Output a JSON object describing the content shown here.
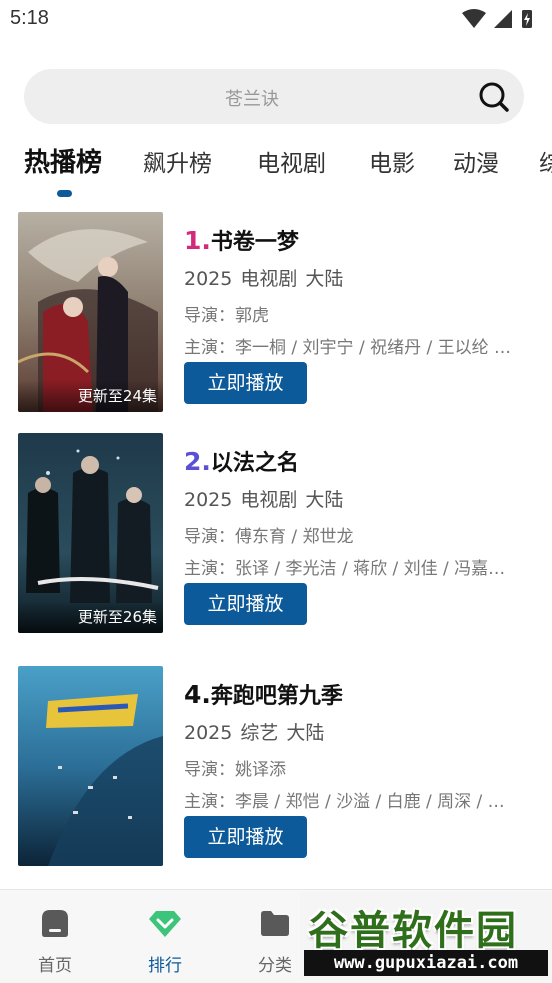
{
  "status_bar": {
    "time": "5:18"
  },
  "search": {
    "placeholder": "苍兰诀"
  },
  "tabs": [
    {
      "label": "热播榜",
      "active": true
    },
    {
      "label": "飙升榜"
    },
    {
      "label": "电视剧"
    },
    {
      "label": "电影"
    },
    {
      "label": "动漫"
    },
    {
      "label": "综"
    }
  ],
  "items": [
    {
      "rank": "1.",
      "rank_color": "#d3297a",
      "title": "书卷一梦",
      "year": "2025",
      "genre": "电视剧",
      "region": "大陆",
      "director": "导演：郭虎",
      "cast": "主演：李一桐 / 刘宇宁 / 祝绪丹 / 王以纶 …",
      "badge": "更新至24集",
      "play_label": "立即播放"
    },
    {
      "rank": "2.",
      "rank_color": "#5b4fd6",
      "title": "以法之名",
      "year": "2025",
      "genre": "电视剧",
      "region": "大陆",
      "director": "导演：傅东育 / 郑世龙",
      "cast": "主演：张译 / 李光洁 / 蒋欣 / 刘佳 / 冯嘉…",
      "badge": "更新至26集",
      "play_label": "立即播放"
    },
    {
      "rank": "4.",
      "rank_color": "#111111",
      "title": "奔跑吧第九季",
      "year": "2025",
      "genre": "综艺",
      "region": "大陆",
      "director": "导演：姚译添",
      "cast": "主演：李晨 / 郑恺 / 沙溢 / 白鹿 / 周深 / …",
      "badge": "",
      "play_label": "立即播放"
    }
  ],
  "nav": [
    {
      "label": "首页",
      "icon": "home-icon"
    },
    {
      "label": "排行",
      "icon": "ranking-diamond-icon",
      "active": true
    },
    {
      "label": "分类",
      "icon": "folder-icon"
    }
  ],
  "watermark": {
    "top": "谷普软件园",
    "bottom": "www.gupuxiazai.com"
  },
  "colors": {
    "accent": "#0d5a9a",
    "rank1": "#d3297a",
    "rank2": "#5b4fd6"
  }
}
